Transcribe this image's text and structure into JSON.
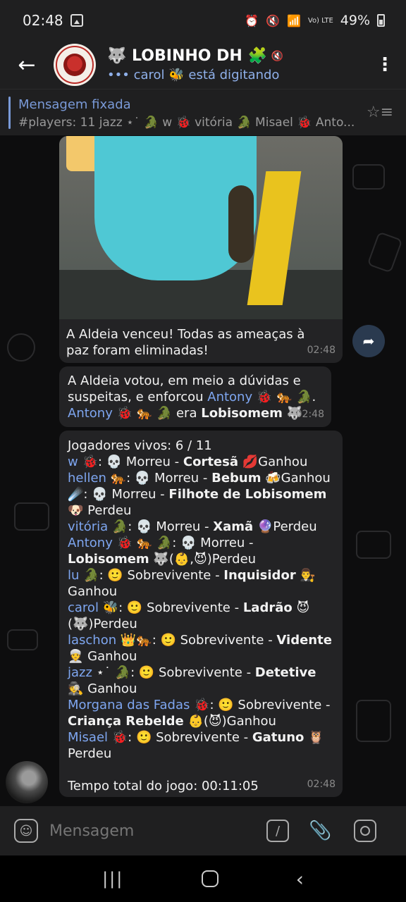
{
  "status_bar": {
    "time": "02:48",
    "icons": [
      "alarm-icon",
      "mute-icon",
      "wifi-icon",
      "lte-icon",
      "signal-icon"
    ],
    "lte": "Vo) LTE",
    "battery": "49%"
  },
  "header": {
    "title": "🐺 LOBINHO DH 🧩",
    "subtitle": "••• carol 🐝 está digitando"
  },
  "pinned": {
    "label": "Mensagem fixada",
    "text": "#players: 11 jazz ⋆˙ 🐊 w 🐞 vitória 🐊 Misael 🐞 Anto..."
  },
  "messages": [
    {
      "text": "A Aldeia venceu! Todas as ameaças à paz foram eliminadas!",
      "time": "02:48"
    },
    {
      "line1": "A Aldeia votou, em meio a dúvidas e suspeitas, e enforcou ",
      "player1": "Antony",
      "emoji1": " 🐞 🐅 🐊.",
      "player2": "Antony",
      "emoji2": " 🐞 🐅 🐊 era ",
      "role": "Lobisomem",
      "role_emoji": " 🐺",
      "time": "02:48"
    },
    {
      "header": "Jogadores vivos: 6 / 11",
      "players": [
        {
          "name": "w",
          "emoji": " 🐞",
          "status": ": 💀 Morreu - ",
          "role": "Cortesã",
          "result": " 💋Ganhou"
        },
        {
          "name": "hellen",
          "emoji": " 🐅",
          "status": ": 💀 Morreu - ",
          "role": "Bebum",
          "result": " 🍻Ganhou"
        },
        {
          "name": "",
          "emoji": "☄️",
          "status": ": 💀 Morreu - ",
          "role": "Filhote de Lobisomem",
          "result": " 🐶 Perdeu"
        },
        {
          "name": "vitória",
          "emoji": " 🐊",
          "status": ": 💀 Morreu - ",
          "role": "Xamã",
          "result": " 🔮Perdeu"
        },
        {
          "name": "Antony",
          "emoji": " 🐞 🐅 🐊",
          "status": ": 💀 Morreu - ",
          "role": "Lobisomem",
          "result": " 🐺(👶,😈)Perdeu"
        },
        {
          "name": "lu",
          "emoji": " 🐊",
          "status": ": 🙂 Sobrevivente - ",
          "role": "Inquisidor",
          "result": " 👨‍⚖️ Ganhou"
        },
        {
          "name": "carol",
          "emoji": " 🐝",
          "status": ": 🙂 Sobrevivente - ",
          "role": "Ladrão",
          "result": " 😈 (🐺)Perdeu"
        },
        {
          "name": "laschon",
          "emoji": " 👑🐅",
          "status": ": 🙂 Sobrevivente - ",
          "role": "Vidente",
          "result": " 👳 Ganhou"
        },
        {
          "name": "jazz",
          "emoji": " ⋆˙ 🐊",
          "status": ": 🙂 Sobrevivente - ",
          "role": "Detetive",
          "result": " 🕵️ Ganhou"
        },
        {
          "name": "Morgana das Fadas",
          "emoji": " 🐞",
          "status": ": 🙂 Sobrevivente - ",
          "role": "Criança Rebelde",
          "result": " 👶(😈)Ganhou"
        },
        {
          "name": "Misael",
          "emoji": " 🐞",
          "status": ": 🙂 Sobrevivente - ",
          "role": "Gatuno",
          "result": " 🦉 Perdeu"
        }
      ],
      "footer": "Tempo total do jogo: 00:11:05",
      "time": "02:48"
    }
  ],
  "input": {
    "placeholder": "Mensagem"
  },
  "colors": {
    "link": "#7ea6f0",
    "bubble": "#232325",
    "bar": "#1f1f20"
  }
}
